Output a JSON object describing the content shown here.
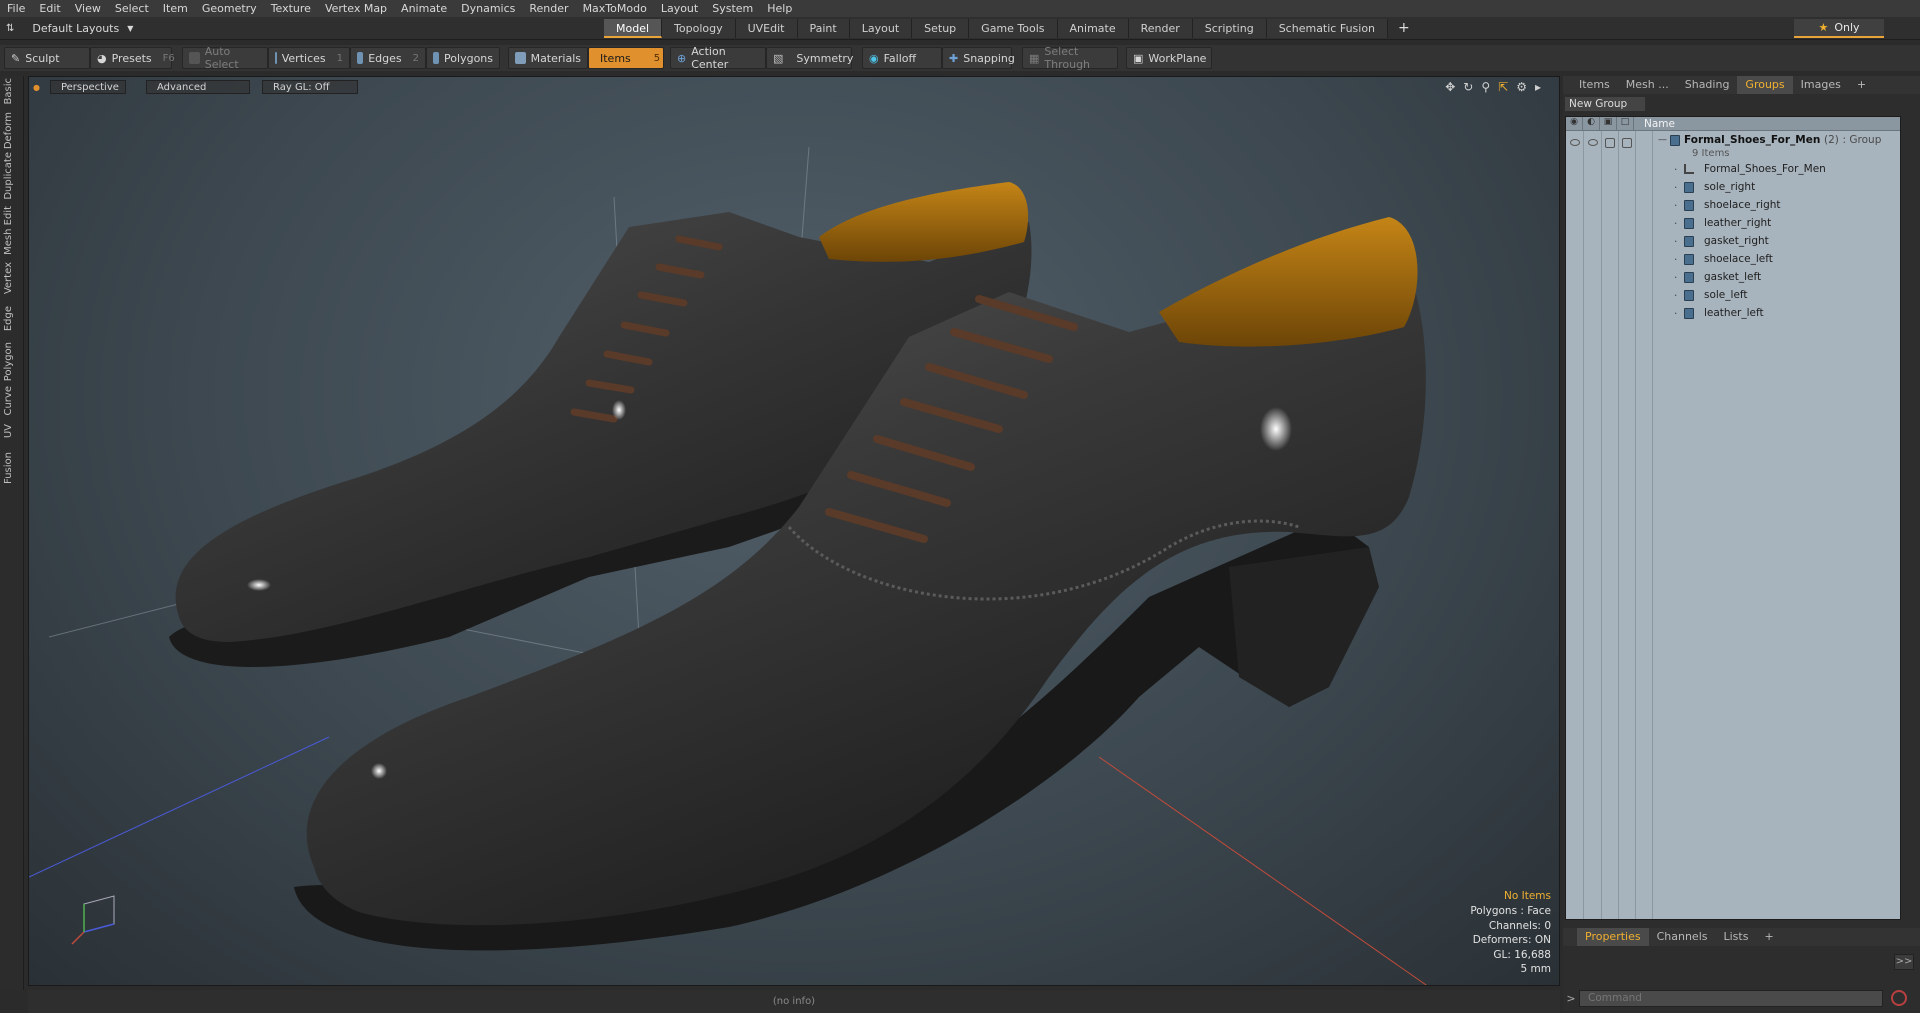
{
  "menu": [
    "File",
    "Edit",
    "View",
    "Select",
    "Item",
    "Geometry",
    "Texture",
    "Vertex Map",
    "Animate",
    "Dynamics",
    "Render",
    "MaxToModo",
    "Layout",
    "System",
    "Help"
  ],
  "layout_selector": "Default Layouts",
  "layout_tabs": [
    "Model",
    "Topology",
    "UVEdit",
    "Paint",
    "Layout",
    "Setup",
    "Game Tools",
    "Animate",
    "Render",
    "Scripting",
    "Schematic Fusion"
  ],
  "layout_tab_plus": "+",
  "only_label": "Only",
  "toolbar": {
    "sculpt": "Sculpt",
    "presets": "Presets",
    "presets_key": "F6",
    "auto_select": "Auto Select",
    "vertices": "Vertices",
    "vertices_key": "1",
    "edges": "Edges",
    "edges_key": "2",
    "polygons": "Polygons",
    "materials": "Materials",
    "items": "Items",
    "items_key": "5",
    "action_center": "Action Center",
    "symmetry": "Symmetry",
    "falloff": "Falloff",
    "snapping": "Snapping",
    "select_through": "Select Through",
    "workplane": "WorkPlane"
  },
  "left_tabs": [
    "Basic",
    "Deform",
    "Duplicate",
    "Mesh Edit",
    "Vertex",
    "Edge",
    "Polygon",
    "Curve",
    "UV",
    "Fusion"
  ],
  "viewport": {
    "view": "Perspective",
    "shading": "Advanced",
    "raygl": "Ray GL: Off"
  },
  "info": {
    "items": "No Items",
    "polygons": "Polygons : Face",
    "channels": "Channels: 0",
    "deformers": "Deformers: ON",
    "gl": "GL: 16,688",
    "scale": "5 mm"
  },
  "status": "(no info)",
  "right_tabs": [
    "Items",
    "Mesh ...",
    "Shading",
    "Groups",
    "Images"
  ],
  "right_tab_plus": "+",
  "new_group": "New Group",
  "tree_header": "Name",
  "group": {
    "name": "Formal_Shoes_For_Men",
    "count": "(2)",
    "kind": ": Group",
    "subcount": "9 Items"
  },
  "tree_items": [
    "Formal_Shoes_For_Men",
    "sole_right",
    "shoelace_right",
    "leather_right",
    "gasket_right",
    "shoelace_left",
    "gasket_left",
    "sole_left",
    "leather_left"
  ],
  "prop_tabs": [
    "Properties",
    "Channels",
    "Lists"
  ],
  "prop_tab_plus": "+",
  "expand_label": ">>",
  "command_placeholder": "Command",
  "colors": {
    "accent": "#e0902c",
    "highlight": "#f0b030",
    "tree_bg": "#a8b4bd",
    "mesh_icon": "#4a6f8e"
  }
}
